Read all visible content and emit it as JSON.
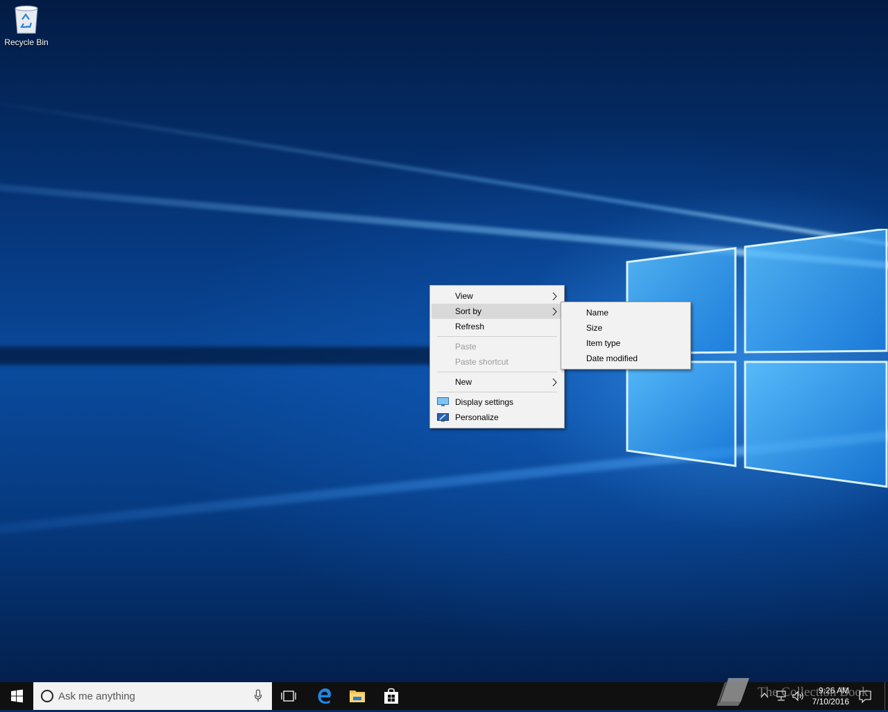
{
  "desktop": {
    "icons": [
      {
        "label": "Recycle Bin",
        "icon": "recycle-bin-icon"
      }
    ]
  },
  "context_menu": {
    "items": [
      {
        "label": "View",
        "has_submenu": true,
        "state": "normal"
      },
      {
        "label": "Sort by",
        "has_submenu": true,
        "state": "highlighted"
      },
      {
        "label": "Refresh",
        "has_submenu": false,
        "state": "normal"
      },
      {
        "label": "Paste",
        "has_submenu": false,
        "state": "disabled"
      },
      {
        "label": "Paste shortcut",
        "has_submenu": false,
        "state": "disabled"
      },
      {
        "label": "New",
        "has_submenu": true,
        "state": "normal"
      },
      {
        "label": "Display settings",
        "icon": "display-icon",
        "state": "normal"
      },
      {
        "label": "Personalize",
        "icon": "personalize-icon",
        "state": "normal"
      }
    ]
  },
  "sort_submenu": {
    "items": [
      {
        "label": "Name"
      },
      {
        "label": "Size"
      },
      {
        "label": "Item type"
      },
      {
        "label": "Date modified"
      }
    ]
  },
  "taskbar": {
    "search_placeholder": "Ask me anything",
    "pinned": [
      "task-view-icon",
      "edge-icon",
      "file-explorer-icon",
      "store-icon"
    ],
    "clock": {
      "time": "9:26 AM",
      "date": "7/10/2016"
    }
  },
  "watermark": {
    "text": "The Collection Book"
  },
  "colors": {
    "taskbar_bg": "#101010",
    "menu_bg": "#f2f2f2",
    "menu_highlight": "#d9d9d9",
    "disabled_text": "#9a9a9a",
    "accent_blue": "#0078d7"
  }
}
